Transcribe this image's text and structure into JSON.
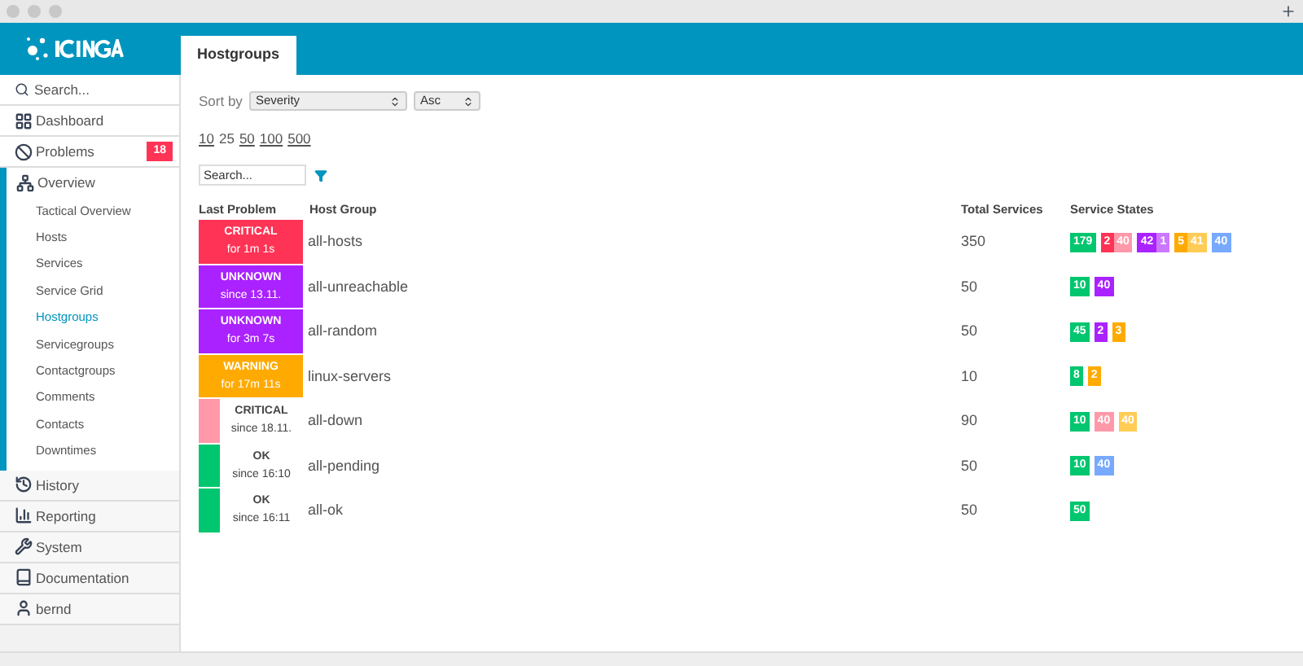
{
  "sidebar": {
    "search": {
      "placeholder": "Search..."
    },
    "items": [
      {
        "kind": "dashboard",
        "label": "Dashboard"
      },
      {
        "kind": "problems",
        "label": "Problems",
        "badge": "18"
      },
      {
        "kind": "overview",
        "label": "Overview",
        "children": [
          {
            "label": "Tactical Overview",
            "selected": false
          },
          {
            "label": "Hosts",
            "selected": false
          },
          {
            "label": "Services",
            "selected": false
          },
          {
            "label": "Service Grid",
            "selected": false
          },
          {
            "label": "Hostgroups",
            "selected": true
          },
          {
            "label": "Servicegroups",
            "selected": false
          },
          {
            "label": "Contactgroups",
            "selected": false
          },
          {
            "label": "Comments",
            "selected": false
          },
          {
            "label": "Contacts",
            "selected": false
          },
          {
            "label": "Downtimes",
            "selected": false
          }
        ]
      },
      {
        "kind": "history",
        "label": "History"
      },
      {
        "kind": "reporting",
        "label": "Reporting"
      },
      {
        "kind": "system",
        "label": "System"
      },
      {
        "kind": "documentation",
        "label": "Documentation"
      },
      {
        "kind": "user",
        "label": "bernd"
      }
    ]
  },
  "tabs": [
    {
      "label": "Hostgroups",
      "selected": true
    }
  ],
  "sort": {
    "label": "Sort by",
    "field": "Severity",
    "order": "Asc"
  },
  "page_sizes": [
    "10",
    "25",
    "50",
    "100",
    "500"
  ],
  "filter": {
    "placeholder": "Search..."
  },
  "table": {
    "columns": [
      "Last Problem",
      "Host Group",
      "Total Services",
      "Service States"
    ],
    "rows": [
      {
        "state": "CRITICAL",
        "since": "for 1m 1s",
        "color": "#ff3355",
        "stripe": false,
        "group": "all-hosts",
        "total": "350",
        "states": [
          [
            {
              "value": "179",
              "color": "#00c66f"
            }
          ],
          [
            {
              "value": "2",
              "color": "#ff3355"
            },
            {
              "value": "40",
              "color": "#ff99aa"
            }
          ],
          [
            {
              "value": "42",
              "color": "#aa22ff"
            },
            {
              "value": "1",
              "color": "#cc77ff"
            }
          ],
          [
            {
              "value": "5",
              "color": "#ffaa00"
            },
            {
              "value": "41",
              "color": "#ffcc55"
            }
          ],
          [
            {
              "value": "40",
              "color": "#77aaff"
            }
          ]
        ]
      },
      {
        "state": "UNKNOWN",
        "since": "since 13.11.",
        "color": "#aa22ff",
        "stripe": false,
        "group": "all-unreachable",
        "total": "50",
        "states": [
          [
            {
              "value": "10",
              "color": "#00c66f"
            }
          ],
          [
            {
              "value": "40",
              "color": "#aa22ff"
            }
          ]
        ]
      },
      {
        "state": "UNKNOWN",
        "since": "for 3m 7s",
        "color": "#aa22ff",
        "stripe": false,
        "group": "all-random",
        "total": "50",
        "states": [
          [
            {
              "value": "45",
              "color": "#00c66f"
            }
          ],
          [
            {
              "value": "2",
              "color": "#aa22ff"
            }
          ],
          [
            {
              "value": "3",
              "color": "#ffaa00"
            }
          ]
        ]
      },
      {
        "state": "WARNING",
        "since": "for 17m 11s",
        "color": "#ffaa00",
        "stripe": false,
        "group": "linux-servers",
        "total": "10",
        "states": [
          [
            {
              "value": "8",
              "color": "#00c66f"
            }
          ],
          [
            {
              "value": "2",
              "color": "#ffaa00"
            }
          ]
        ]
      },
      {
        "state": "CRITICAL",
        "since": "since 18.11.",
        "color": "#ff99aa",
        "stripe": true,
        "group": "all-down",
        "total": "90",
        "states": [
          [
            {
              "value": "10",
              "color": "#00c66f"
            }
          ],
          [
            {
              "value": "40",
              "color": "#ff99aa"
            }
          ],
          [
            {
              "value": "40",
              "color": "#ffcc55"
            }
          ]
        ]
      },
      {
        "state": "OK",
        "since": "since 16:10",
        "color": "#00c66f",
        "stripe": true,
        "group": "all-pending",
        "total": "50",
        "states": [
          [
            {
              "value": "10",
              "color": "#00c66f"
            }
          ],
          [
            {
              "value": "40",
              "color": "#77aaff"
            }
          ]
        ]
      },
      {
        "state": "OK",
        "since": "since 16:11",
        "color": "#00c66f",
        "stripe": true,
        "group": "all-ok",
        "total": "50",
        "states": [
          [
            {
              "value": "50",
              "color": "#00c66f"
            }
          ]
        ]
      }
    ]
  }
}
